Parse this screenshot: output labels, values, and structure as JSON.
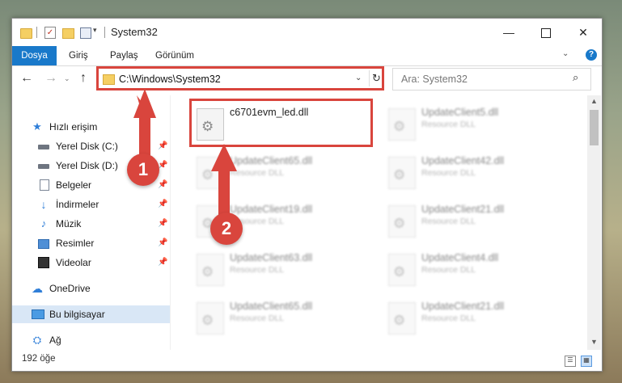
{
  "window": {
    "title": "System32"
  },
  "ribbon": {
    "tabs": [
      "Dosya",
      "Giriş",
      "Paylaş",
      "Görünüm"
    ],
    "help": "?"
  },
  "address": {
    "path": "C:\\Windows\\System32"
  },
  "search": {
    "placeholder": "Ara: System32"
  },
  "sidebar": {
    "items": [
      {
        "label": "Hızlı erişim"
      },
      {
        "label": "Yerel Disk (C:)"
      },
      {
        "label": "Yerel Disk (D:)"
      },
      {
        "label": "Belgeler"
      },
      {
        "label": "İndirmeler"
      },
      {
        "label": "Müzik"
      },
      {
        "label": "Resimler"
      },
      {
        "label": "Videolar"
      },
      {
        "label": "OneDrive"
      },
      {
        "label": "Bu bilgisayar"
      },
      {
        "label": "Ağ"
      }
    ]
  },
  "files": [
    {
      "name": "c6701evm_led.dll",
      "type": ""
    },
    {
      "name": "UpdateClient5.dll",
      "type": "Resource DLL"
    },
    {
      "name": "UpdateClient65.dll",
      "type": "Resource DLL"
    },
    {
      "name": "UpdateClient42.dll",
      "type": "Resource DLL"
    },
    {
      "name": "UpdateClient19.dll",
      "type": "Resource DLL"
    },
    {
      "name": "UpdateClient21.dll",
      "type": "Resource DLL"
    },
    {
      "name": "UpdateClient63.dll",
      "type": "Resource DLL"
    },
    {
      "name": "UpdateClient4.dll",
      "type": "Resource DLL"
    },
    {
      "name": "UpdateClient65.dll",
      "type": "Resource DLL"
    },
    {
      "name": "UpdateClient21.dll",
      "type": "Resource DLL"
    }
  ],
  "status": {
    "count": "192 öğe"
  },
  "callouts": [
    "1",
    "2"
  ],
  "colors": {
    "accent": "#1979ca",
    "highlight": "#d9453d"
  }
}
